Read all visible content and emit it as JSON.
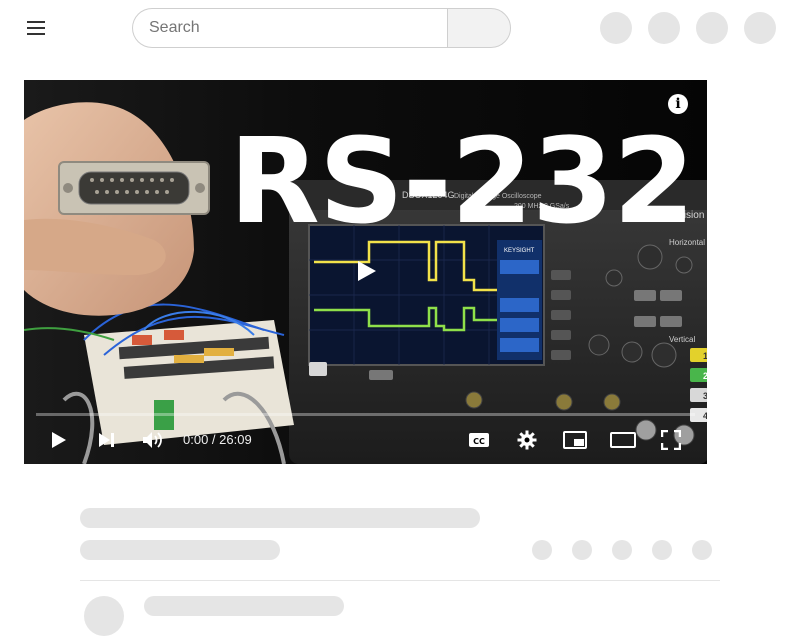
{
  "header": {
    "search": {
      "placeholder": "Search",
      "value": ""
    },
    "icons": [
      "menu-icon",
      "search-icon",
      "account-circle-icon"
    ]
  },
  "player": {
    "thumbnail_title": "RS-232",
    "info_glyph": "i",
    "time": {
      "current": "0:00",
      "duration": "26:09",
      "separator": " / "
    },
    "progress": 0,
    "controls": [
      "play-icon",
      "next-icon",
      "volume-icon",
      "cc-icon",
      "settings-icon",
      "miniplayer-icon",
      "theater-icon",
      "fullscreen-icon"
    ],
    "scene_text": {
      "scope_brand": "KEYSIGHT",
      "scope_model": "DSOX1204G",
      "scope_desc": "Digital Storage Oscilloscope",
      "scope_bw": "200 MHz 2 GSa/s",
      "scope_series": "InfiniiVision",
      "panel_horizontal": "Horizontal",
      "panel_vertical": "Vertical",
      "channels": [
        "1",
        "2",
        "3",
        "4"
      ]
    }
  },
  "colors": {
    "accent_progress": "#ff0000",
    "skeleton": "#e5e5e5",
    "ch1_trace": "#f2e24a",
    "ch2_trace": "#8fe04a"
  }
}
